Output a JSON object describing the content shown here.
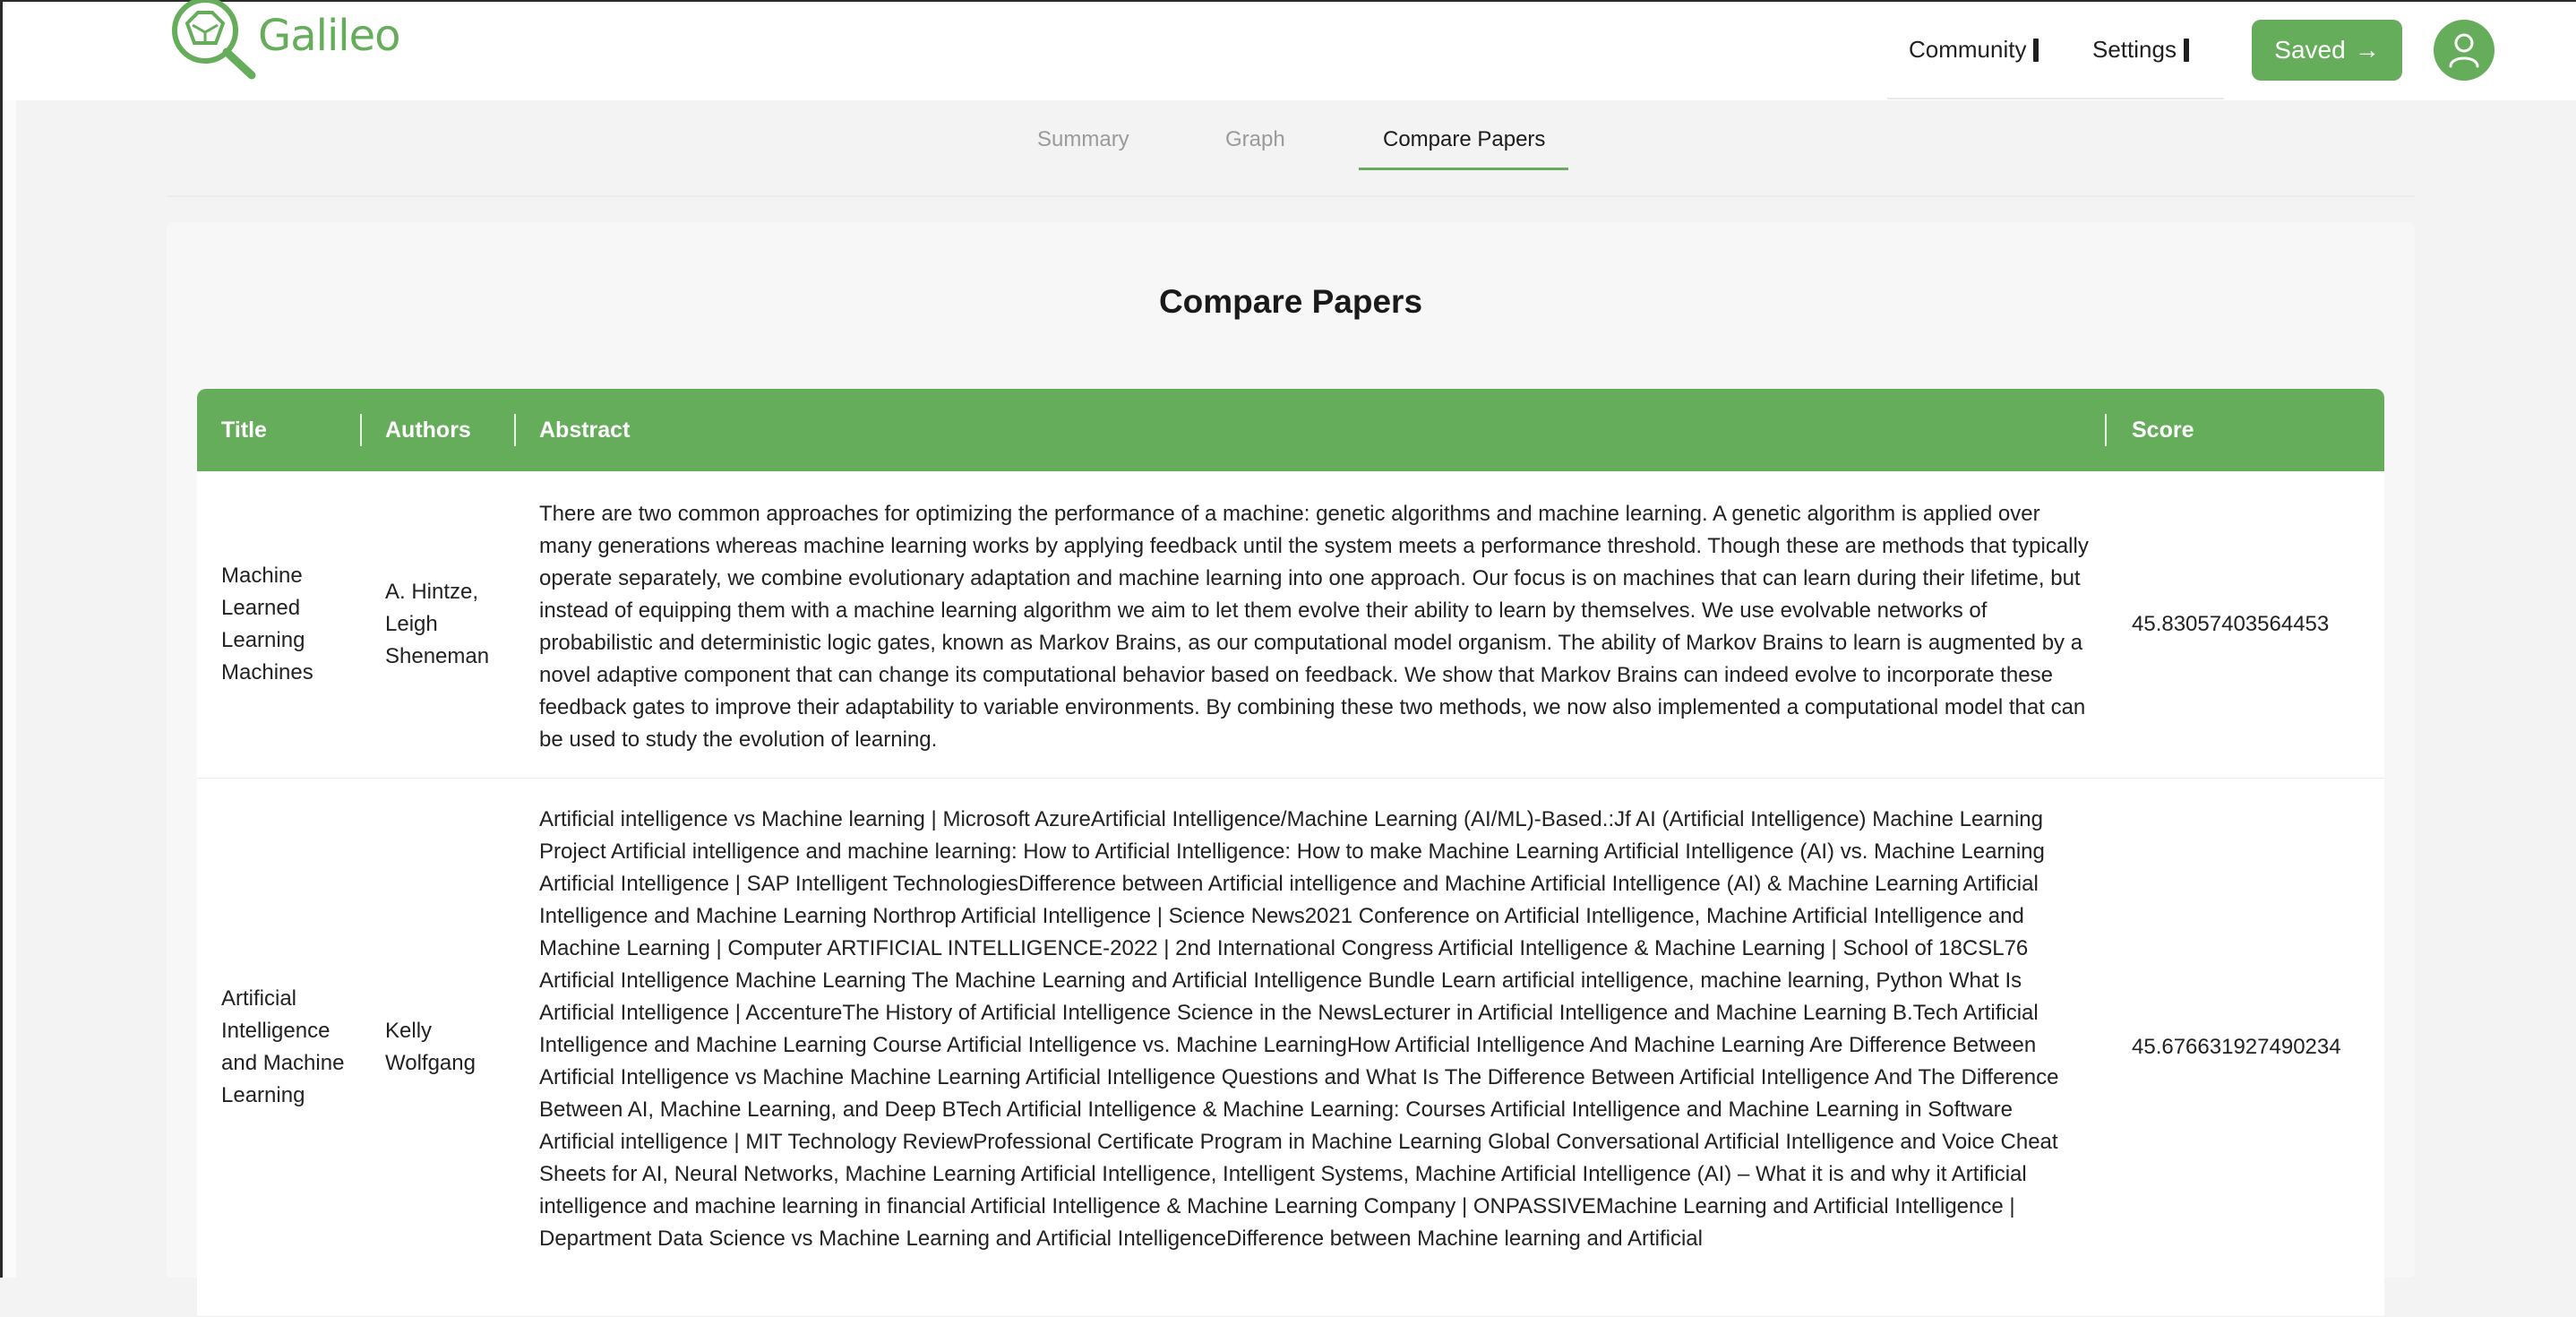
{
  "app": {
    "logo_text": "Galileo"
  },
  "header": {
    "nav": [
      {
        "label": "Community"
      },
      {
        "label": "Settings"
      }
    ],
    "saved_label": "Saved",
    "saved_arrow": "→"
  },
  "tabs": [
    {
      "label": "Summary",
      "active": false
    },
    {
      "label": "Graph",
      "active": false
    },
    {
      "label": "Compare Papers",
      "active": true
    }
  ],
  "page": {
    "title": "Compare Papers"
  },
  "table": {
    "columns": [
      "Title",
      "Authors",
      "Abstract",
      "Score"
    ],
    "rows": [
      {
        "title": "Machine Learned Learning Machines",
        "authors": "A. Hintze, Leigh Sheneman",
        "abstract": "There are two common approaches for optimizing the performance of a machine: genetic algorithms and machine learning. A genetic algorithm is applied over many generations whereas machine learning works by applying feedback until the system meets a performance threshold. Though these are methods that typically operate separately, we combine evolutionary adaptation and machine learning into one approach. Our focus is on machines that can learn during their lifetime, but instead of equipping them with a machine learning algorithm we aim to let them evolve their ability to learn by themselves. We use evolvable networks of probabilistic and deterministic logic gates, known as Markov Brains, as our computational model organism. The ability of Markov Brains to learn is augmented by a novel adaptive component that can change its computational behavior based on feedback. We show that Markov Brains can indeed evolve to incorporate these feedback gates to improve their adaptability to variable environments. By combining these two methods, we now also implemented a computational model that can be used to study the evolution of learning.",
        "score": "45.83057403564453"
      },
      {
        "title": "Artificial Intelligence and Machine Learning",
        "authors": "Kelly Wolfgang",
        "abstract": "Artificial intelligence vs Machine learning | Microsoft AzureArtificial Intelligence/Machine Learning (AI/ML)-Based.:Jf AI (Artificial Intelligence) Machine Learning Project Artificial intelligence and machine learning: How to Artificial Intelligence: How to make Machine Learning Artificial Intelligence (AI) vs. Machine Learning Artificial Intelligence | SAP Intelligent TechnologiesDifference between Artificial intelligence and Machine Artificial Intelligence (AI) & Machine Learning Artificial Intelligence and Machine Learning Northrop Artificial Intelligence | Science News2021 Conference on Artificial Intelligence, Machine Artificial Intelligence and Machine Learning | Computer ARTIFICIAL INTELLIGENCE-2022 | 2nd International Congress Artificial Intelligence & Machine Learning | School of 18CSL76 Artificial Intelligence Machine Learning The Machine Learning and Artificial Intelligence Bundle Learn artificial intelligence, machine learning, Python What Is Artificial Intelligence | AccentureThe History of Artificial Intelligence Science in the NewsLecturer in Artificial Intelligence and Machine Learning B.Tech Artificial Intelligence and Machine Learning Course Artificial Intelligence vs. Machine LearningHow Artificial Intelligence And Machine Learning Are Difference Between Artificial Intelligence vs Machine Machine Learning Artificial Intelligence Questions and What Is The Difference Between Artificial Intelligence And The Difference Between AI, Machine Learning, and Deep BTech Artificial Intelligence & Machine Learning: Courses Artificial Intelligence and Machine Learning in Software Artificial intelligence | MIT Technology ReviewProfessional Certificate Program in Machine Learning Global Conversational Artificial Intelligence and Voice Cheat Sheets for AI, Neural Networks, Machine Learning Artificial Intelligence, Intelligent Systems, Machine Artificial Intelligence (AI) – What it is and why it Artificial intelligence and machine learning in financial Artificial Intelligence & Machine Learning Company | ONPASSIVEMachine Learning and Artificial Intelligence | Department Data Science vs Machine Learning and Artificial IntelligenceDifference between Machine learning and Artificial",
        "score": "45.676631927490234"
      }
    ]
  },
  "colors": {
    "accent": "#66ad5b",
    "header_bg": "#ffffff",
    "page_bg": "#f3f3f3",
    "card_bg": "#f7f7f7"
  },
  "icons": {
    "logo": "magnifier-globe-icon",
    "nav_caret": "caret-icon",
    "avatar": "user-icon"
  }
}
